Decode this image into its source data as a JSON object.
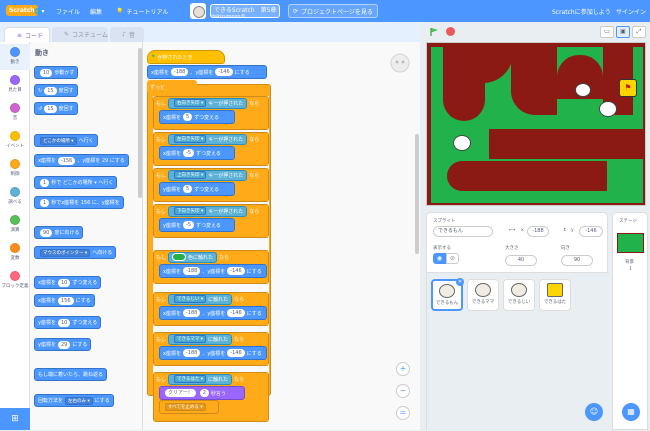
{
  "topbar": {
    "logo": "Scratch",
    "file": "ファイル",
    "edit": "編集",
    "tutorial": "チュートリアル",
    "project_title": "できるScratch　第5章",
    "author": "dekirumosn®",
    "see_project": "プロジェクトページを見る",
    "join": "Scratchに参加しよう",
    "signin": "サインイン",
    "accent": "#4c97ff"
  },
  "tabs": {
    "code": "コード",
    "costume": "コスチューム",
    "sound": "音"
  },
  "categories": [
    {
      "label": "動き",
      "color": "#4c97ff"
    },
    {
      "label": "見た目",
      "color": "#9966ff"
    },
    {
      "label": "音",
      "color": "#cf63cf"
    },
    {
      "label": "イベント",
      "color": "#ffbf00"
    },
    {
      "label": "制御",
      "color": "#ffab19"
    },
    {
      "label": "調べる",
      "color": "#5cb1d6"
    },
    {
      "label": "演算",
      "color": "#59c059"
    },
    {
      "label": "変数",
      "color": "#ff8c1a"
    },
    {
      "label": "ブロック定義",
      "color": "#ff6680"
    }
  ],
  "palette": {
    "title": "動き",
    "blocks": [
      {
        "pre": "",
        "pill": "10",
        "post": "歩動かす"
      },
      {
        "pre": "↻",
        "pill": "15",
        "post": "度回す"
      },
      {
        "pre": "↺",
        "pill": "15",
        "post": "度回す"
      },
      {
        "pre": "",
        "pill": "どこかの場所 ▾",
        "post": "へ行く"
      },
      {
        "pre": "x座標を",
        "pill": "-156",
        "post": "、y座標を 29 にする"
      },
      {
        "pre": "",
        "pill": "1",
        "post": "秒で どこかの場所 ▾ へ行く"
      },
      {
        "pre": "",
        "pill": "1",
        "post": "秒でx座標を 156 に、y座標を"
      },
      {
        "pre": "",
        "pill": "90",
        "post": "度に向ける"
      },
      {
        "pre": "",
        "pill": "マウスのポインター ▾",
        "post": "へ向ける"
      },
      {
        "pre": "x座標を",
        "pill": "10",
        "post": "ずつ変える"
      },
      {
        "pre": "x座標を",
        "pill": "156",
        "post": "にする"
      },
      {
        "pre": "y座標を",
        "pill": "10",
        "post": "ずつ変える"
      },
      {
        "pre": "y座標を",
        "pill": "29",
        "post": "にする"
      },
      {
        "pre": "もし端に着いたら、跳ね返る",
        "pill": "",
        "post": ""
      },
      {
        "pre": "回転方法を",
        "pill": "左右のみ ▾",
        "post": "にする"
      }
    ]
  },
  "script": {
    "hat": "が押されたとき",
    "goto1": {
      "a": "x座標を",
      "x": "-188",
      "b": "、y座標を",
      "y": "-146",
      "c": "にする"
    },
    "forever": "ずっと",
    "if": "もし",
    "then": "なら",
    "key_pressed": "キーが押された",
    "keys": [
      "右向き矢印 ▾",
      "左向き矢印 ▾",
      "上向き矢印 ▾",
      "下向き矢印 ▾"
    ],
    "moves": [
      {
        "a": "x座標を",
        "v": "5",
        "b": "ずつ変える"
      },
      {
        "a": "x座標を",
        "v": "-5",
        "b": "ずつ変える"
      },
      {
        "a": "y座標を",
        "v": "5",
        "b": "ずつ変える"
      },
      {
        "a": "y座標を",
        "v": "-5",
        "b": "ずつ変える"
      }
    ],
    "color_touch": "色に触れた",
    "touched": "に触れた",
    "touch_targets": [
      "できるじい ▾",
      "できるママ ▾",
      "できるはた ▾"
    ],
    "goto_rep": {
      "a": "x座標を",
      "x": "-188",
      "b": "、y座標を",
      "y": "-146",
      "c": "にする"
    },
    "say_text": "クリアー！",
    "say_sec": "2",
    "say_post": "秒言う",
    "stop_all": "すべてを止める ▾"
  },
  "zoom": {
    "in": "+",
    "out": "−",
    "reset": "="
  },
  "sprite_info": {
    "sprite_label": "スプライト",
    "sprite_name": "できるもん",
    "x_label": "x",
    "x": "-188",
    "y_label": "y",
    "y": "-146",
    "show_label": "表示する",
    "size_label": "大きさ",
    "size": "40",
    "dir_label": "向き",
    "dir": "90"
  },
  "sprites": [
    "できるもん",
    "できるママ",
    "できるじい",
    "できるはた"
  ],
  "stage_pane": {
    "title": "ステージ",
    "backdrop_label": "背景",
    "backdrop_count": "1"
  }
}
